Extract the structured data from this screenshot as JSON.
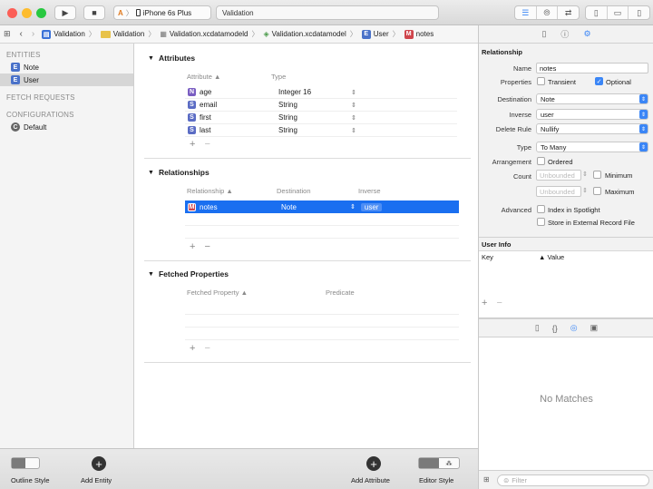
{
  "toolbar": {
    "scheme_target": "A",
    "scheme_device": "iPhone 6s Plus",
    "activity_text": "Validation"
  },
  "pathbar": {
    "crumbs": [
      "Validation",
      "Validation",
      "Validation.xcdatamodeld",
      "Validation.xcdatamodel",
      "User",
      "notes"
    ]
  },
  "sidebar": {
    "entities_header": "ENTITIES",
    "entities": [
      {
        "badge": "E",
        "label": "Note"
      },
      {
        "badge": "E",
        "label": "User"
      }
    ],
    "fetch_header": "FETCH REQUESTS",
    "config_header": "CONFIGURATIONS",
    "configs": [
      {
        "badge": "C",
        "label": "Default"
      }
    ]
  },
  "editor": {
    "attributes": {
      "title": "Attributes",
      "col_attr": "Attribute",
      "col_type": "Type",
      "rows": [
        {
          "badge": "N",
          "name": "age",
          "type": "Integer 16"
        },
        {
          "badge": "S",
          "name": "email",
          "type": "String"
        },
        {
          "badge": "S",
          "name": "first",
          "type": "String"
        },
        {
          "badge": "S",
          "name": "last",
          "type": "String"
        }
      ]
    },
    "relationships": {
      "title": "Relationships",
      "col_rel": "Relationship",
      "col_dest": "Destination",
      "col_inv": "Inverse",
      "rows": [
        {
          "badge": "M",
          "name": "notes",
          "dest": "Note",
          "inv": "user"
        }
      ]
    },
    "fetched": {
      "title": "Fetched Properties",
      "col_prop": "Fetched Property",
      "col_pred": "Predicate"
    }
  },
  "bottom": {
    "outline_style": "Outline Style",
    "add_entity": "Add Entity",
    "add_attribute": "Add Attribute",
    "editor_style": "Editor Style"
  },
  "inspector": {
    "section": "Relationship",
    "name_label": "Name",
    "name_value": "notes",
    "properties_label": "Properties",
    "transient": "Transient",
    "optional": "Optional",
    "destination_label": "Destination",
    "destination_value": "Note",
    "inverse_label": "Inverse",
    "inverse_value": "user",
    "delete_rule_label": "Delete Rule",
    "delete_rule_value": "Nullify",
    "type_label": "Type",
    "type_value": "To Many",
    "arrangement_label": "Arrangement",
    "ordered": "Ordered",
    "count_label": "Count",
    "unbounded": "Unbounded",
    "minimum": "Minimum",
    "maximum": "Maximum",
    "advanced_label": "Advanced",
    "index_spotlight": "Index in Spotlight",
    "store_external": "Store in External Record File",
    "user_info": "User Info",
    "col_key": "Key",
    "col_value": "Value",
    "no_matches": "No Matches",
    "filter_placeholder": "Filter"
  },
  "colors": {
    "accent": "#3b86f6",
    "selection": "#1a6ff0",
    "badge_n": "#7a5ec2",
    "badge_s": "#5b6cc4",
    "badge_m": "#d0454c",
    "badge_e": "#4a72c9"
  }
}
